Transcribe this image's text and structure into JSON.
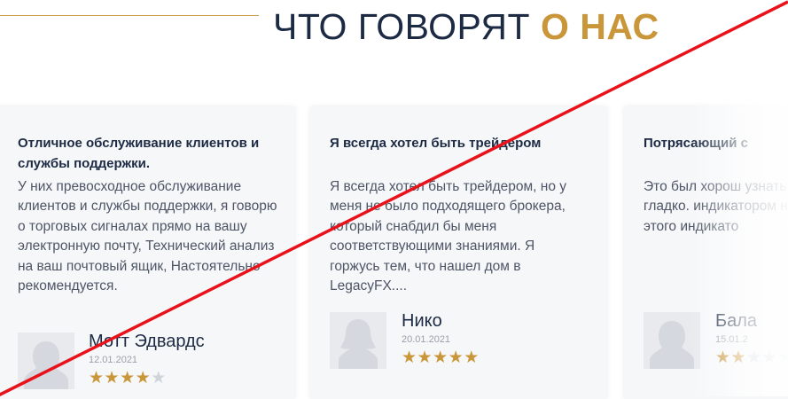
{
  "section": {
    "heading_main": "ЧТО ГОВОРЯТ ",
    "heading_accent": "О НАС"
  },
  "reviews": [
    {
      "title": "Отличное обслуживание клиентов и службы поддержки.",
      "text": "У них превосходное обслуживание клиентов и службы поддержки, я говорю о торговых сигналах прямо на вашу электронную почту, Технический анализ на ваш почтовый ящик, Настоятельно рекомендуется.",
      "author": "Мотт Эдвардс",
      "date": "12.01.2021",
      "rating": 4
    },
    {
      "title": "Я всегда хотел быть трейдером",
      "text": "Я всегда хотел быть трейдером, но у меня не было подходящего брокера, который снабдил бы меня соответствующими знаниями. Я горжусь тем, что нашел дом в LegacyFX....",
      "author": "Нико",
      "date": "20.01.2021",
      "rating": 5
    },
    {
      "title": "Потрясающий с",
      "text": "Это был хорош узнать об индик прошла гладко. индикатором на так как я не зна этого индикато",
      "author": "Бала",
      "date": "15.01.2",
      "rating": 2
    }
  ],
  "colors": {
    "accent": "#c9963a",
    "heading": "#1c2a43",
    "strike": "#e8121b"
  },
  "icons": {
    "star": "star-icon",
    "avatar": "user-silhouette-icon"
  }
}
